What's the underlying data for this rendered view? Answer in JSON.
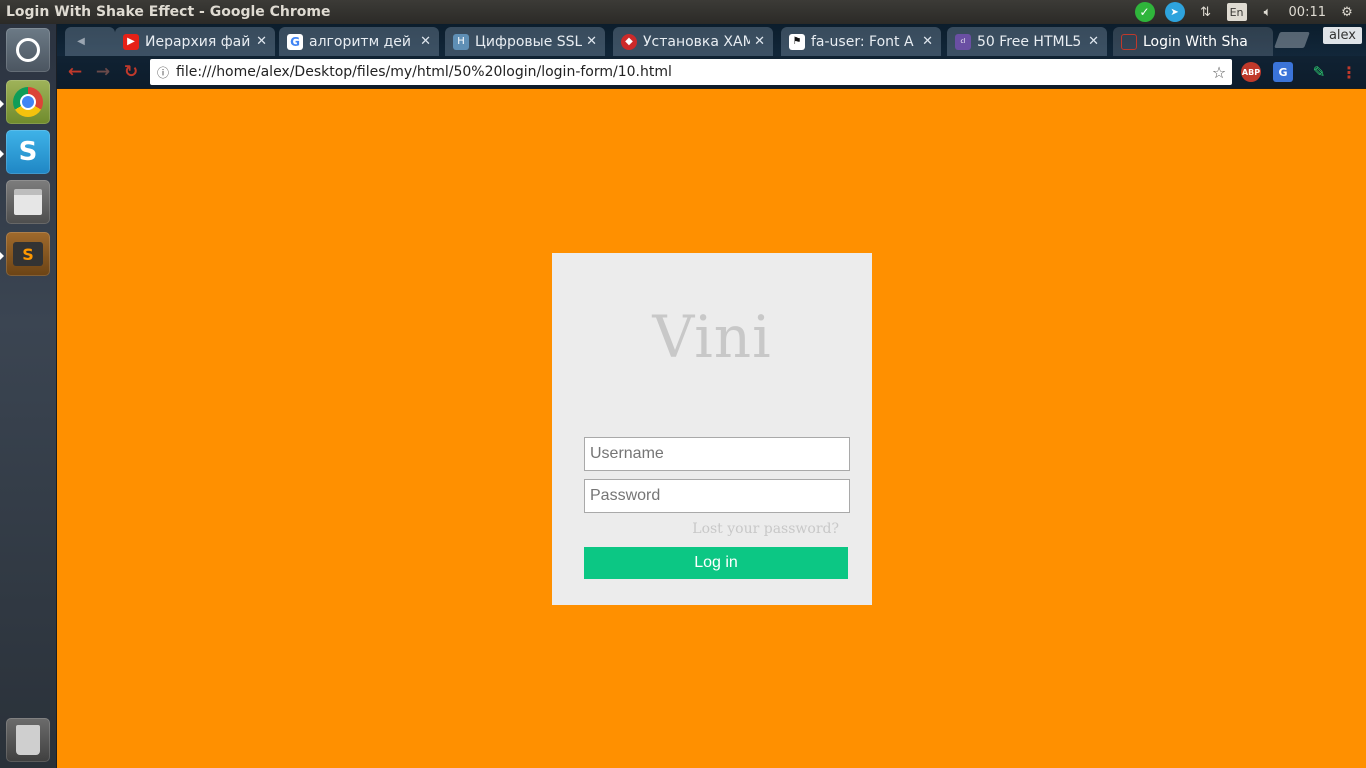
{
  "os": {
    "window_title": "Login With Shake Effect - Google Chrome",
    "keyboard_layout": "En",
    "clock": "00:11",
    "icons": [
      "check-shield-icon",
      "telegram-icon",
      "network-icon",
      "volume-icon",
      "settings-gear-icon"
    ]
  },
  "launcher": {
    "items": [
      "dash-home",
      "google-chrome",
      "skype",
      "files",
      "sublime-text",
      "trash"
    ]
  },
  "browser": {
    "tabs": [
      {
        "title": "",
        "favicon": "speaker-icon",
        "favicon_color": "#5d6d7e"
      },
      {
        "title": "Иерархия фай",
        "favicon": "youtube-icon",
        "favicon_color": "#e62117"
      },
      {
        "title": "алгоритм дей",
        "favicon": "google-icon",
        "favicon_color": "#4285f4"
      },
      {
        "title": "Цифровые SSL",
        "favicon": "h-icon",
        "favicon_color": "#5f8fb5"
      },
      {
        "title": "Установка XAM",
        "favicon": "ruby-icon",
        "favicon_color": "#cc2a2a"
      },
      {
        "title": "fa-user: Font A",
        "favicon": "flag-icon",
        "favicon_color": "#111111"
      },
      {
        "title": "50 Free HTML5",
        "favicon": "colorlib-icon",
        "favicon_color": "#6a4fa3"
      },
      {
        "title": "Login With Sha",
        "favicon": "page-icon",
        "favicon_color": "#c0392b"
      }
    ],
    "profile_name": "alex",
    "url": "file:///home/alex/Desktop/files/my/html/50%20login/login-form/10.html",
    "extensions": [
      "ABP",
      "G",
      "pen",
      "menu"
    ]
  },
  "page": {
    "background_color": "#ff9000",
    "brand": "Vini",
    "username_placeholder": "Username",
    "password_placeholder": "Password",
    "lost_password": "Lost your password?",
    "login_button": "Log in",
    "button_color": "#0cc784"
  }
}
